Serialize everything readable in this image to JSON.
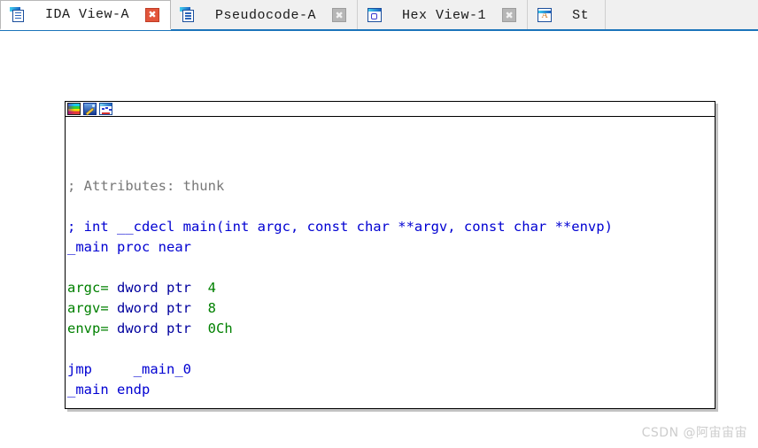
{
  "window": {
    "background_color": "#ffffff"
  },
  "tabbar": {
    "accent_color": "#1b74ba",
    "tabs": [
      {
        "label": "IDA View-A",
        "icon": "document-icon",
        "active": true,
        "close_label": "✖",
        "close_color": "#e2553b"
      },
      {
        "label": "Pseudocode-A",
        "icon": "document-icon",
        "active": false,
        "close_label": "✖",
        "close_color": "#b6b6b6"
      },
      {
        "label": "Hex View-1",
        "icon": "hex-icon",
        "active": false,
        "close_label": "✖",
        "close_color": "#b6b6b6"
      },
      {
        "label": "St",
        "icon": "structures-icon",
        "active": false,
        "close_label": "",
        "close_color": "#b6b6b6"
      }
    ]
  },
  "code_panel": {
    "toolbar": {
      "buttons": [
        {
          "name": "palette-icon",
          "title": "Graph overview colors"
        },
        {
          "name": "pencil-icon",
          "title": "Edit"
        },
        {
          "name": "graph-icon",
          "title": "Graph view"
        }
      ]
    },
    "lines": [
      {
        "id": "l1",
        "text": "",
        "segments": []
      },
      {
        "id": "l2",
        "text": "; Attributes: thunk",
        "segments": [
          {
            "t": "; Attributes: thunk",
            "c": "c-comment"
          }
        ]
      },
      {
        "id": "l3",
        "text": "",
        "segments": []
      },
      {
        "id": "l4",
        "text": "; int __cdecl main(int argc, const char **argv, const char **envp)",
        "segments": [
          {
            "t": "; int __cdecl main(int argc, const char **argv, const char **envp)",
            "c": "c-blue"
          }
        ]
      },
      {
        "id": "l5",
        "text": "_main proc near",
        "segments": [
          {
            "t": "_main proc near",
            "c": "c-blue"
          }
        ]
      },
      {
        "id": "l6",
        "text": "",
        "segments": []
      },
      {
        "id": "l7",
        "text": "argc= dword ptr  4",
        "segments": [
          {
            "t": "argc=",
            "c": "c-green"
          },
          {
            "t": " dword ptr  ",
            "c": "c-navy"
          },
          {
            "t": "4",
            "c": "c-green"
          }
        ]
      },
      {
        "id": "l8",
        "text": "argv= dword ptr  8",
        "segments": [
          {
            "t": "argv=",
            "c": "c-green"
          },
          {
            "t": " dword ptr  ",
            "c": "c-navy"
          },
          {
            "t": "8",
            "c": "c-green"
          }
        ]
      },
      {
        "id": "l9",
        "text": "envp= dword ptr  0Ch",
        "segments": [
          {
            "t": "envp=",
            "c": "c-green"
          },
          {
            "t": " dword ptr  ",
            "c": "c-navy"
          },
          {
            "t": "0Ch",
            "c": "c-green"
          }
        ]
      },
      {
        "id": "l10",
        "text": "",
        "segments": []
      },
      {
        "id": "l11",
        "text": "jmp     _main_0",
        "segments": [
          {
            "t": "jmp     _main_0",
            "c": "c-blue"
          }
        ]
      },
      {
        "id": "l12",
        "text": "_main endp",
        "segments": [
          {
            "t": "_main endp",
            "c": "c-blue"
          }
        ]
      }
    ]
  },
  "watermark": {
    "text": "CSDN @阿宙宙宙",
    "color": "#cdcdcd"
  }
}
